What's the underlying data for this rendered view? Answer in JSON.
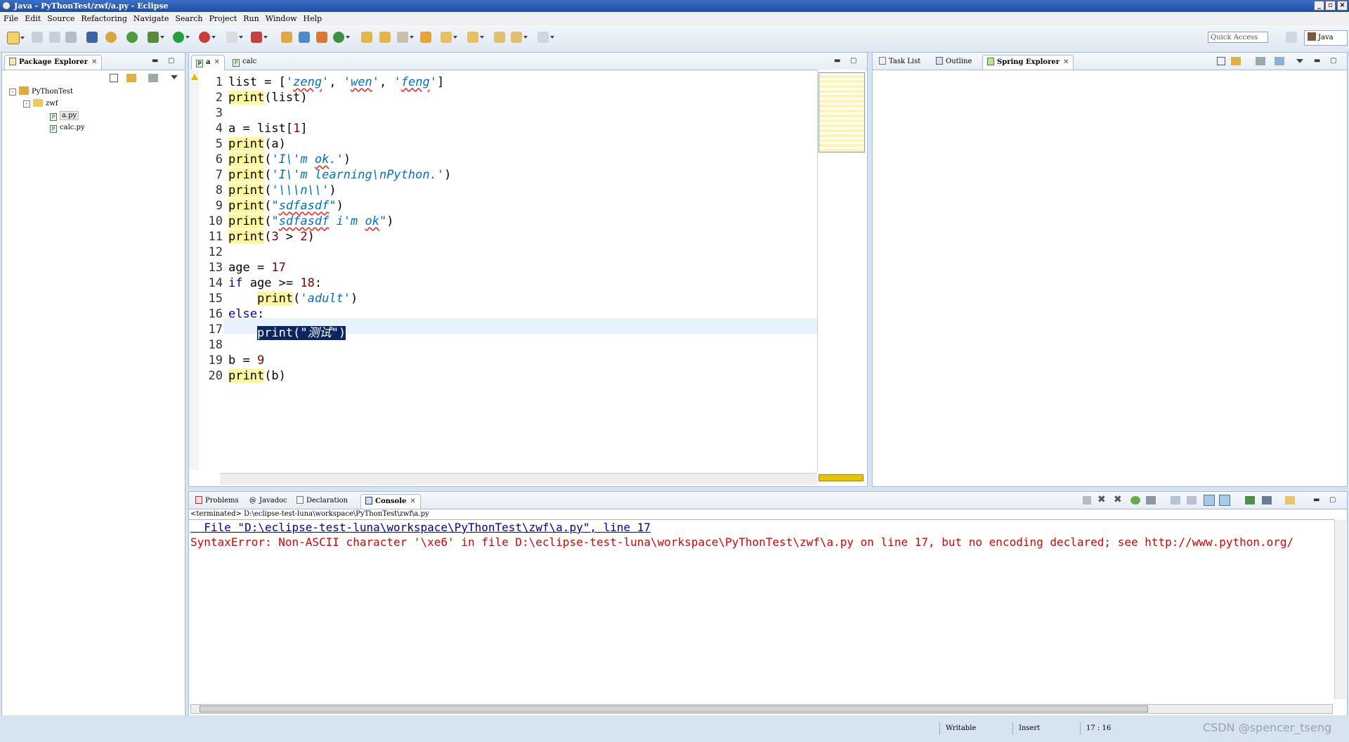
{
  "window": {
    "title": "Java - PyThonTest/zwf/a.py - Eclipse"
  },
  "menu": [
    "File",
    "Edit",
    "Source",
    "Refactoring",
    "Navigate",
    "Search",
    "Project",
    "Run",
    "Window",
    "Help"
  ],
  "quick_access": {
    "placeholder": "Quick Access"
  },
  "perspective": {
    "label": "Java"
  },
  "package_explorer": {
    "tab": "Package Explorer",
    "tree": [
      {
        "label": "PyThonTest",
        "level": 0,
        "kind": "project"
      },
      {
        "label": "zwf",
        "level": 1,
        "kind": "folder"
      },
      {
        "label": "a.py",
        "level": 2,
        "kind": "pyfile",
        "selected": true
      },
      {
        "label": "calc.py",
        "level": 2,
        "kind": "pyfile"
      }
    ]
  },
  "editor": {
    "tabs": [
      {
        "label": "a",
        "active": true
      },
      {
        "label": "calc",
        "active": false
      }
    ],
    "current_line": 17,
    "lines": [
      "list = ['zeng', 'wen', 'feng']",
      "print(list)",
      "",
      "a = list[1]",
      "print(a)",
      "print('I\\'m ok.')",
      "print('I\\'m learning\\nPython.')",
      "print('\\\\\\n\\\\')",
      "print(\"sdfasdf\")",
      "print(\"sdfasdf i'm ok\")",
      "print(3 > 2)",
      "",
      "age = 17",
      "if age >= 18:",
      "    print('adult')",
      "else:",
      "    print(\"测试\")",
      "",
      "b = 9",
      "print(b)"
    ]
  },
  "right_panel": {
    "tabs": [
      "Task List",
      "Outline",
      "Spring Explorer"
    ]
  },
  "bottom_panel": {
    "tabs": [
      "Problems",
      "Javadoc",
      "Declaration",
      "Console"
    ]
  },
  "console": {
    "header": "<terminated> D:\\eclipse-test-luna\\workspace\\PyThonTest\\zwf\\a.py",
    "link_line": "  File \"D:\\eclipse-test-luna\\workspace\\PyThonTest\\zwf\\a.py\", line 17",
    "error_line": "SyntaxError: Non-ASCII character '\\xe6' in file D:\\eclipse-test-luna\\workspace\\PyThonTest\\zwf\\a.py on line 17, but no encoding declared; see http://www.python.org/"
  },
  "status": {
    "writable": "Writable",
    "insert": "Insert",
    "position": "17 : 16",
    "watermark": "CSDN @spencer_tseng"
  },
  "colors": {
    "keyword": "#0000c0",
    "string": "#0070c8",
    "number": "#800000",
    "error": "#e00000",
    "link": "#0000a0",
    "selection": "#0b2661"
  }
}
